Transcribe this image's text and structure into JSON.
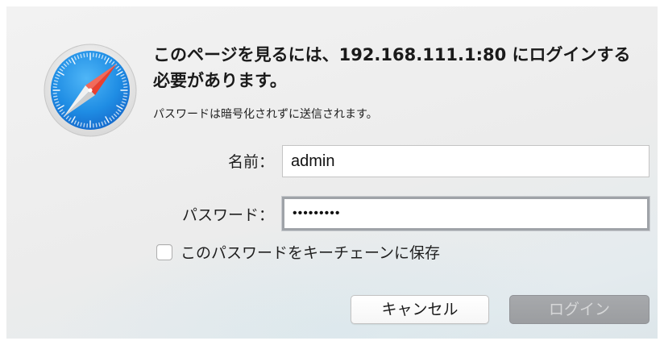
{
  "dialog": {
    "message": "このページを見るには、192.168.111.1:80 にログインする必要があります。",
    "sub_message": "パスワードは暗号化されずに送信されます。",
    "name_label": "名前：",
    "name_value": "admin",
    "password_label": "パスワード：",
    "password_value": "•••••••••",
    "save_keychain_label": "このパスワードをキーチェーンに保存",
    "save_keychain_checked": false,
    "cancel_label": "キャンセル",
    "login_label": "ログイン"
  },
  "icons": {
    "app": "safari-compass-icon"
  },
  "colors": {
    "compass_blue": "#1f8de4",
    "needle_red": "#e8402f",
    "login_button_disabled": "#a3a5a8"
  }
}
